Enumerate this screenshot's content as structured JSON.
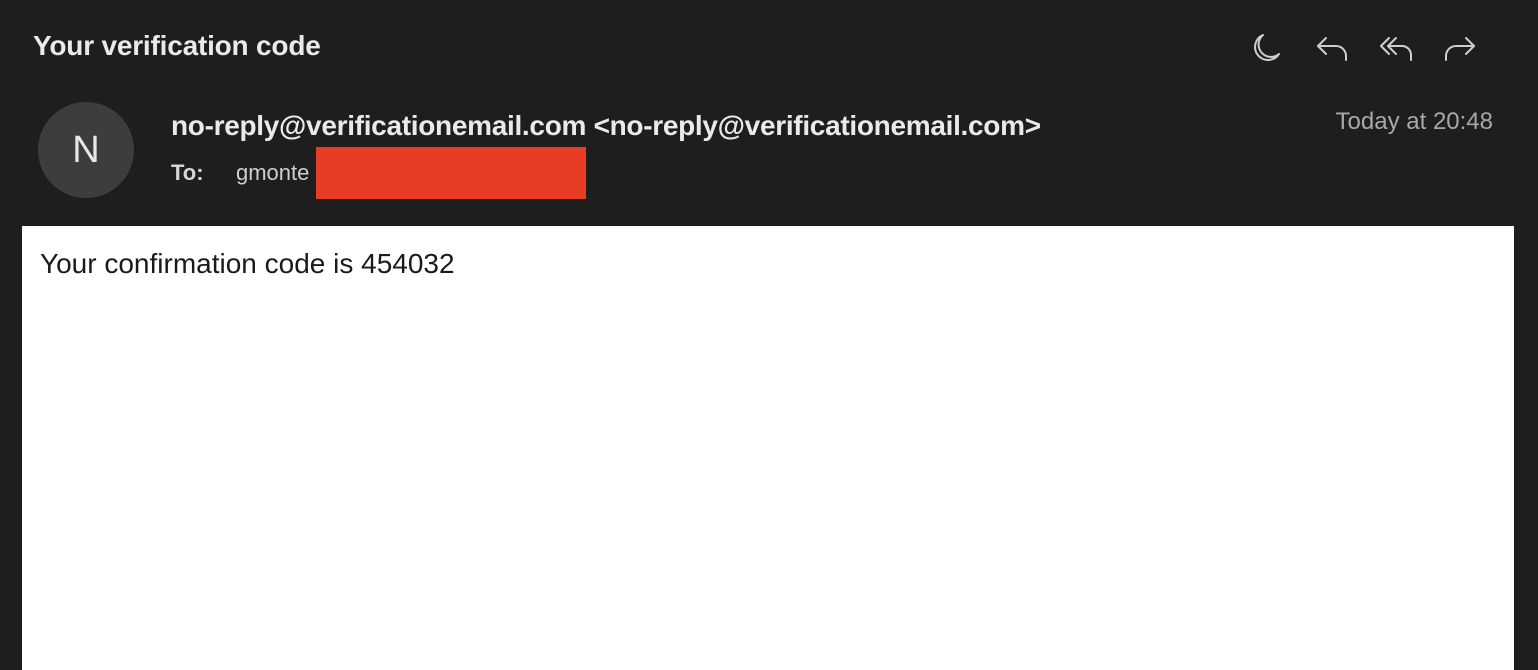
{
  "message": {
    "subject": "Your verification code",
    "avatar_initial": "N",
    "sender": "no-reply@verificationemail.com <no-reply@verificationemail.com>",
    "to_label": "To:",
    "to_value": "gmonte",
    "date": "Today at 20:48",
    "body": "Your confirmation code is 454032"
  },
  "toolbar": {
    "icons": [
      "moon-icon",
      "reply-icon",
      "reply-all-icon",
      "forward-icon"
    ],
    "icon_color": "#cfcfcf"
  },
  "colors": {
    "background": "#1e1e1e",
    "body_background": "#ffffff",
    "redaction": "#e83d24",
    "avatar": "#3d3d3d"
  }
}
